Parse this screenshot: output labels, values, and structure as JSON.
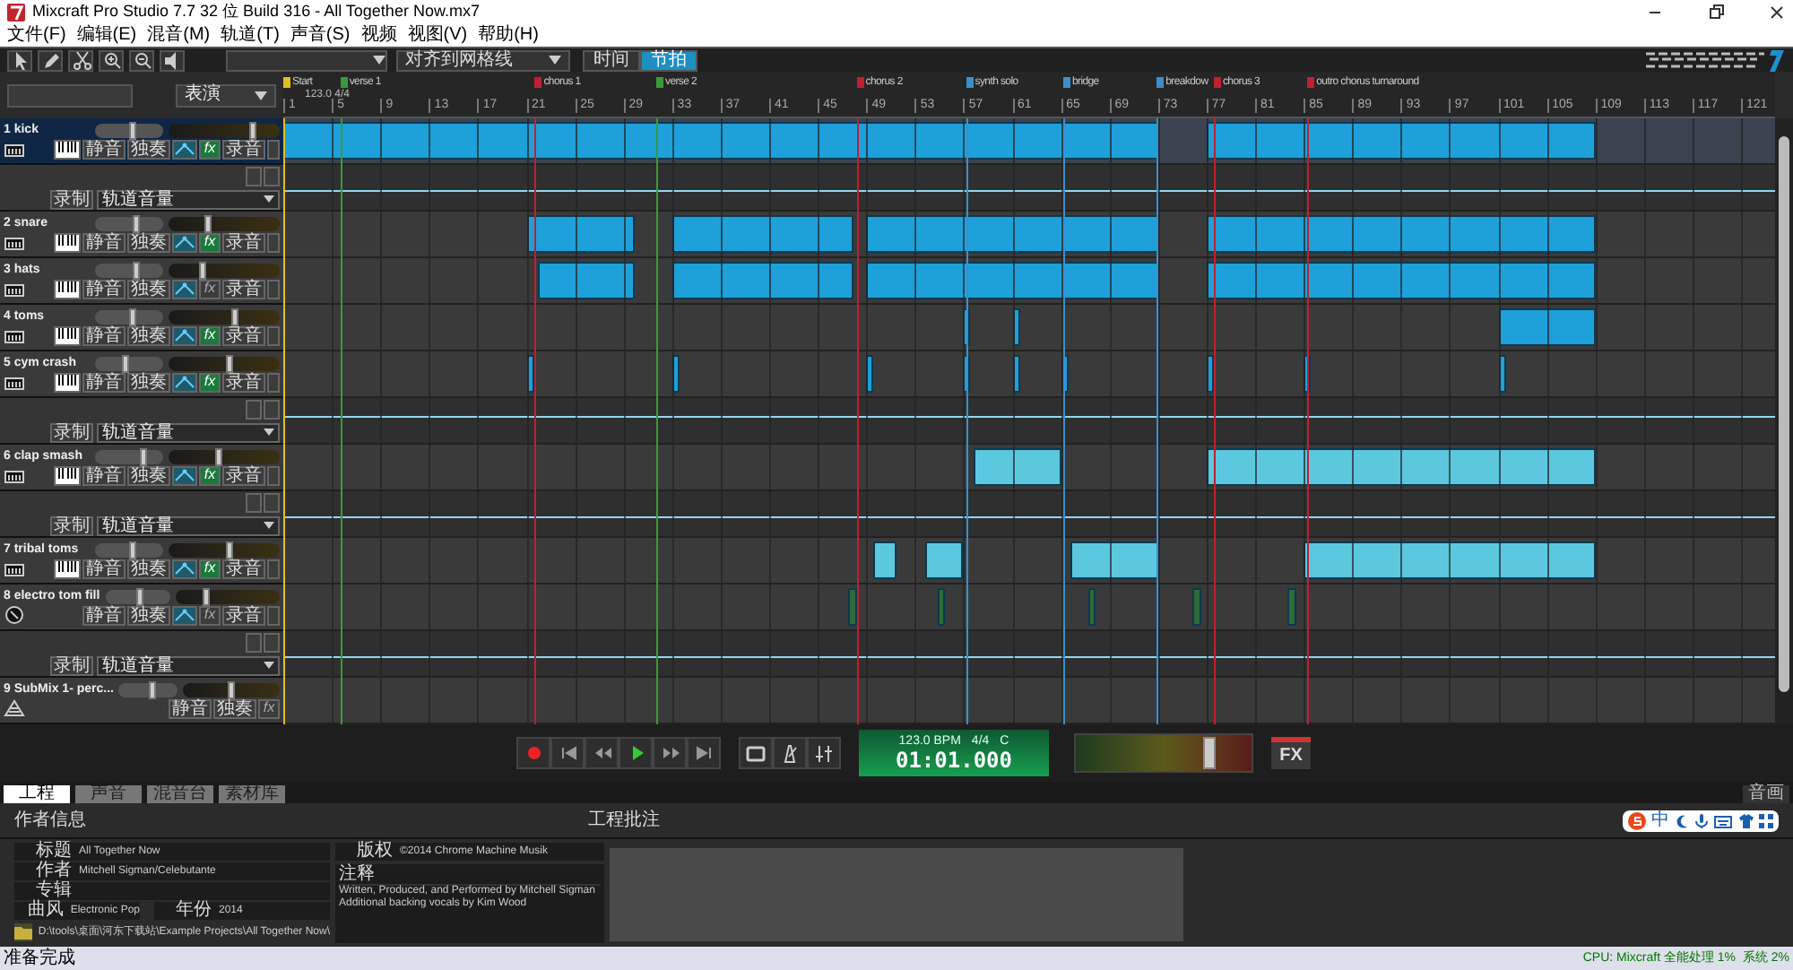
{
  "window": {
    "title": "Mixcraft Pro Studio 7.7 32 位 Build 316 - All Together Now.mx7"
  },
  "menu": [
    "文件(F)",
    "编辑(E)",
    "混音(M)",
    "轨道(T)",
    "声音(S)",
    "视频",
    "视图(V)",
    "帮助(H)"
  ],
  "toolbar": {
    "snap": "对齐到网格线",
    "time_modes": [
      {
        "label": "时间",
        "selected": false
      },
      {
        "label": "节拍",
        "selected": true
      }
    ]
  },
  "header": {
    "view_mode": "表演"
  },
  "ruler": {
    "tempo": "123.0 4/4",
    "bars": [
      "1",
      "5",
      "9",
      "13",
      "17",
      "21",
      "25",
      "29",
      "33",
      "37",
      "41",
      "45",
      "49",
      "53",
      "57",
      "61",
      "65",
      "69",
      "73",
      "77",
      "81",
      "85",
      "89",
      "93",
      "97",
      "101",
      "105",
      "109",
      "113",
      "117",
      "121"
    ],
    "markers": [
      {
        "label": "Start",
        "color": "#e0c020"
      },
      {
        "label": "verse 1",
        "color": "#3a9a3a"
      },
      {
        "label": "chorus 1",
        "color": "#c02030"
      },
      {
        "label": "verse 2",
        "color": "#3a9a3a"
      },
      {
        "label": "chorus 2",
        "color": "#c02030"
      },
      {
        "label": "synth solo",
        "color": "#3a8fd0"
      },
      {
        "label": "bridge",
        "color": "#3a8fd0"
      },
      {
        "label": "breakdow",
        "color": "#3a8fd0"
      },
      {
        "label": "chorus 3",
        "color": "#c02030"
      },
      {
        "label": "outro chorus turnaround",
        "color": "#c02030"
      }
    ]
  },
  "tracks": [
    {
      "kind": "instrument",
      "name": "1 kick",
      "selected": true,
      "color": "#1ea0da",
      "volume": {
        "level": 0.55
      },
      "pan": {
        "level": 0.75
      },
      "mute": "静音",
      "solo": "独奏",
      "fx": "fx",
      "fx_on": true,
      "arm": "录音",
      "automation": {
        "record": "录制",
        "param": "轨道音量"
      }
    },
    {
      "kind": "instrument",
      "name": "2 snare",
      "selected": false,
      "color": "#1ea0da",
      "volume": {
        "level": 0.6
      },
      "pan": {
        "level": 0.35
      },
      "mute": "静音",
      "solo": "独奏",
      "fx": "fx",
      "fx_on": true,
      "arm": "录音"
    },
    {
      "kind": "instrument",
      "name": "3 hats",
      "selected": false,
      "color": "#1ea0da",
      "volume": {
        "level": 0.6
      },
      "pan": {
        "level": 0.3
      },
      "mute": "静音",
      "solo": "独奏",
      "fx": "fx",
      "fx_on": false,
      "arm": "录音"
    },
    {
      "kind": "instrument",
      "name": "4 toms",
      "selected": false,
      "color": "#1ea0da",
      "volume": {
        "level": 0.55
      },
      "pan": {
        "level": 0.6
      },
      "mute": "静音",
      "solo": "独奏",
      "fx": "fx",
      "fx_on": true,
      "arm": "录音"
    },
    {
      "kind": "instrument",
      "name": "5 cym crash",
      "selected": false,
      "color": "#1ea0da",
      "volume": {
        "level": 0.45
      },
      "pan": {
        "level": 0.55
      },
      "mute": "静音",
      "solo": "独奏",
      "fx": "fx",
      "fx_on": true,
      "arm": "录音",
      "automation": {
        "record": "录制",
        "param": "轨道音量"
      }
    },
    {
      "kind": "instrument",
      "name": "6 clap smash",
      "selected": false,
      "color": "#5cc8e0",
      "volume": {
        "level": 0.7
      },
      "pan": {
        "level": 0.45
      },
      "mute": "静音",
      "solo": "独奏",
      "fx": "fx",
      "fx_on": true,
      "arm": "录音",
      "automation": {
        "record": "录制",
        "param": "轨道音量"
      }
    },
    {
      "kind": "instrument",
      "name": "7 tribal toms",
      "selected": false,
      "color": "#5cc8e0",
      "volume": {
        "level": 0.55
      },
      "pan": {
        "level": 0.55
      },
      "mute": "静音",
      "solo": "独奏",
      "fx": "fx",
      "fx_on": true,
      "arm": "录音"
    },
    {
      "kind": "audio",
      "name": "8 electro tom fill",
      "selected": false,
      "color": "#2f6a3a",
      "volume": {
        "level": 0.55
      },
      "pan": {
        "level": 0.3
      },
      "mute": "静音",
      "solo": "独奏",
      "fx": "fx",
      "fx_on": false,
      "arm": "录音",
      "automation": {
        "record": "录制",
        "param": "轨道音量"
      }
    },
    {
      "kind": "submix",
      "name": "9 SubMix 1- perc...",
      "selected": false,
      "volume": {
        "level": 0.55
      },
      "pan": {
        "level": 0.5
      },
      "mute": "静音",
      "solo": "独奏",
      "fx": "fx",
      "fx_on": false
    }
  ],
  "transport": {
    "tempo": "123.0 BPM",
    "meter": "4/4",
    "key": "C",
    "time": "01:01.000",
    "master": {
      "level": 0.75
    },
    "fx": "FX"
  },
  "bottom_tabs": [
    {
      "label": "工程",
      "selected": true
    },
    {
      "label": "声音",
      "selected": false
    },
    {
      "label": "混音台",
      "selected": false
    },
    {
      "label": "素材库",
      "selected": false
    }
  ],
  "bottom_right_tab": "音画",
  "project": {
    "heading": "作者信息",
    "notes_heading": "工程批注",
    "fields": [
      {
        "label": "标题",
        "value": "All Together Now"
      },
      {
        "label": "作者",
        "value": "Mitchell Sigman/Celebutante"
      },
      {
        "label": "专辑"
      },
      {
        "label": "曲风",
        "value": "Electronic Pop"
      },
      {
        "label": "年份",
        "value": "2014"
      }
    ],
    "copyright": {
      "label": "版权",
      "value": "©2014 Chrome Machine Musik"
    },
    "comments": {
      "label": "注释",
      "lines": [
        "Written, Produced, and Performed by Mitchell Sigman",
        "Additional backing vocals by Kim Wood"
      ]
    },
    "path": "D:\\tools\\桌面\\河东下载站\\Example Projects\\All Together Now\\"
  },
  "ime": {
    "mode": "中"
  },
  "status_bar": {
    "text": "准备完成",
    "cpu": "CPU: Mixcraft 全能处理 1%  系统 2%"
  }
}
